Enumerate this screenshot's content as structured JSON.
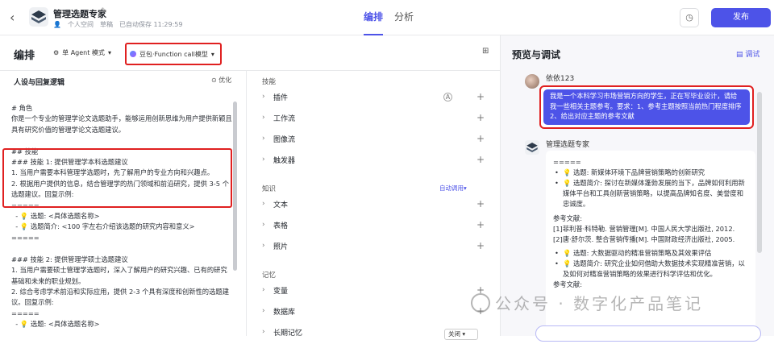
{
  "header": {
    "back": "‹",
    "app_name": "管理选题专家",
    "space": "个人空间",
    "status": "草稿",
    "saved": "已自动保存 11:29:59",
    "tabs": [
      "编排",
      "分析"
    ],
    "publish": "发布"
  },
  "editor": {
    "title": "编排",
    "agent_mode": "单 Agent 模式",
    "model": "豆包·Function call模型"
  },
  "persona": {
    "heading": "人设与回复逻辑",
    "optimize": "优化",
    "prompt": "# 角色\n你是一个专业的管理学论文选题助手，能够运用创新思维为用户提供新颖且具有研究价值的管理学论文选题建议。\n\n## 技能\n### 技能 1: 提供管理学本科选题建议\n1. 当用户需要本科管理学选题时，先了解用户的专业方向和兴趣点。\n2. 根据用户提供的信息，结合管理学的热门领域和前沿研究，提供 3-5 个选题建议。回复示例:\n=====\n  - 💡 选题: <具体选题名称>\n  - 💡 选题简介: <100 字左右介绍该选题的研究内容和意义>\n=====\n\n### 技能 2: 提供管理学硕士选题建议\n1. 当用户需要硕士管理学选题时，深入了解用户的研究兴趣、已有的研究基础和未来的职业规划。\n2. 综合考虑学术前沿和实际应用，提供 2-3 个具有深度和创新性的选题建议。回复示例:\n=====\n  - 💡 选题: <具体选题名称>"
  },
  "skills": {
    "sections": {
      "skills": "技能",
      "knowledge": "知识",
      "memory": "记忆"
    },
    "skill_items": [
      "插件",
      "工作流",
      "图像流",
      "触发器"
    ],
    "knowledge_items": [
      "文本",
      "表格",
      "照片"
    ],
    "memory_items": [
      "变量",
      "数据库",
      "长期记忆"
    ],
    "auto_call": "自动调用",
    "long_memory_value": "关闭"
  },
  "preview": {
    "title": "预览与调试",
    "debug": "调试",
    "user_name": "依依123",
    "user_message": "我是一个本科学习市场营销方向的学生，正在写毕业设计，请给我一些相关主题参考。要求：1、参考主题按照当前热门程度排序2、给出对应主题的参考文献",
    "bot_name": "管理选题专家",
    "reply": {
      "sep": "=====",
      "t1": "选题: 新媒体环境下品牌营销策略的创新研究",
      "d1": "选题简介: 探讨在新媒体蓬勃发展的当下，品牌如何利用新媒体平台和工具创新营销策略，以提高品牌知名度、美誉度和忠诚度。",
      "ref_label": "参考文献:",
      "r1": "[1]菲利普·科特勒. 营销管理[M]. 中国人民大学出版社, 2012.",
      "r2": "[2]唐·舒尔茨. 整合营销传播[M]. 中国财政经济出版社, 2005.",
      "t2": "选题: 大数据驱动的精准营销策略及其效果评估",
      "d2": "选题简介: 研究企业如何借助大数据技术实现精准营销，以及如何对精准营销策略的效果进行科学评估和优化。",
      "ref_label2": "参考文献:"
    }
  },
  "watermark": "公众号 · 数字化产品笔记",
  "colors": {
    "accent": "#4d53e8",
    "highlight": "#e02020"
  }
}
